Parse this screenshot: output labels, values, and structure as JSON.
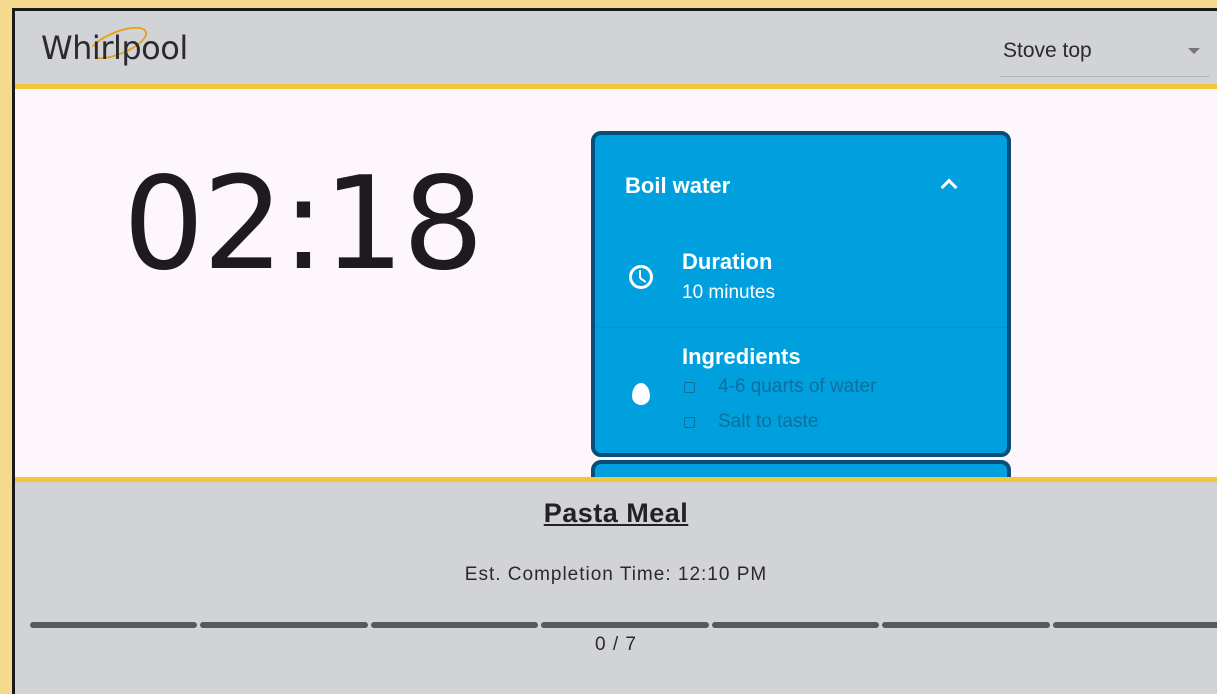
{
  "header": {
    "logo_text": "Whirlpool",
    "mode_select": {
      "value": "Stove top"
    }
  },
  "timer": {
    "display": "02:18"
  },
  "step_card": {
    "title": "Boil water",
    "duration": {
      "label": "Duration",
      "value": "10 minutes",
      "icon": "clock-icon"
    },
    "ingredients": {
      "label": "Ingredients",
      "icon": "egg-icon",
      "items": [
        {
          "text": "4-6 quarts of water",
          "checked": false
        },
        {
          "text": "Salt to taste",
          "checked": false
        }
      ]
    }
  },
  "footer": {
    "meal_title": "Pasta Meal",
    "eta": "Est. Completion Time: 12:10 PM",
    "progress": {
      "completed": 0,
      "total": 7,
      "label": "0 / 7"
    }
  },
  "colors": {
    "accent_yellow": "#f2c53c",
    "card_blue": "#00a0df",
    "card_border": "#0a4c7a",
    "bar_gray": "#d2d3d6"
  }
}
